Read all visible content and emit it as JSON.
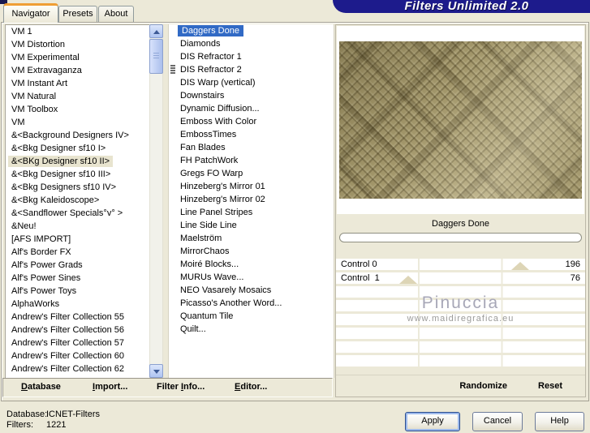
{
  "window": {
    "title": "Filters Unlimited 2.0",
    "tabs": [
      {
        "label": "Navigator",
        "active": true
      },
      {
        "label": "Presets",
        "active": false
      },
      {
        "label": "About",
        "active": false
      }
    ]
  },
  "categories": {
    "selected_index": 10,
    "items": [
      "VM 1",
      "VM Distortion",
      "VM Experimental",
      "VM Extravaganza",
      "VM Instant Art",
      "VM Natural",
      "VM Toolbox",
      "VM",
      "&<Background Designers IV>",
      "&<Bkg Designer sf10 I>",
      "&<BKg Designer sf10 II>",
      "&<Bkg Designer sf10 III>",
      "&<Bkg Designers sf10 IV>",
      "&<Bkg Kaleidoscope>",
      "&<Sandflower Specials°v° >",
      "&Neu!",
      "[AFS IMPORT]",
      "Alf's Border FX",
      "Alf's Power Grads",
      "Alf's Power Sines",
      "Alf's Power Toys",
      "AlphaWorks",
      "Andrew's Filter Collection 55",
      "Andrew's Filter Collection 56",
      "Andrew's Filter Collection 57",
      "Andrew's Filter Collection 60",
      "Andrew's Filter Collection 62"
    ]
  },
  "filters": {
    "selected_index": 0,
    "grip_index": 3,
    "items": [
      "Daggers Done",
      "Diamonds",
      "DIS Refractor 1",
      "DIS Refractor 2",
      "DIS Warp (vertical)",
      "Downstairs",
      "Dynamic Diffusion...",
      "Emboss With Color",
      "EmbossTimes",
      "Fan Blades",
      "FH PatchWork",
      "Gregs FO Warp",
      "Hinzeberg's Mirror 01",
      "Hinzeberg's Mirror 02",
      "Line Panel Stripes",
      "Line Side Line",
      "Maelström",
      "MirrorChaos",
      "Moiré Blocks...",
      "MURUs Wave...",
      "NEO Vasarely Mosaics",
      "Picasso's Another Word...",
      "Quantum Tile",
      "Quilt..."
    ]
  },
  "preview": {
    "filter_name": "Daggers Done"
  },
  "controls": {
    "rows": [
      {
        "label": "Control 0",
        "value": "196",
        "pos": 0.74
      },
      {
        "label": "Control  1",
        "value": "76",
        "pos": 0.29
      }
    ],
    "empty_rows": 6
  },
  "watermark": {
    "line1": "Pinuccia",
    "line2": "www.maidiregrafica.eu"
  },
  "toolbar": {
    "items": [
      {
        "key": "database",
        "label": "Database",
        "underline": 0
      },
      {
        "key": "import",
        "label": "Import...",
        "underline": 0
      },
      {
        "key": "filter-info",
        "label": "Filter Info...",
        "underline": 7
      },
      {
        "key": "editor",
        "label": "Editor...",
        "underline": 0
      }
    ],
    "randomize": "Randomize",
    "reset": "Reset"
  },
  "status": {
    "database_label": "Database:",
    "database_value": "ICNET-Filters",
    "filters_label": "Filters:",
    "filters_value": "1221"
  },
  "buttons": {
    "apply": "Apply",
    "cancel": "Cancel",
    "help": "Help"
  },
  "colors": {
    "dialog_bg": "#ece9d8",
    "title_band": "#1d1b8c",
    "selection_blue": "#316ac5",
    "category_selection": "#e8e4cf",
    "active_tab_accent": "#ef9e34",
    "preview_base": "#a89c6f"
  }
}
